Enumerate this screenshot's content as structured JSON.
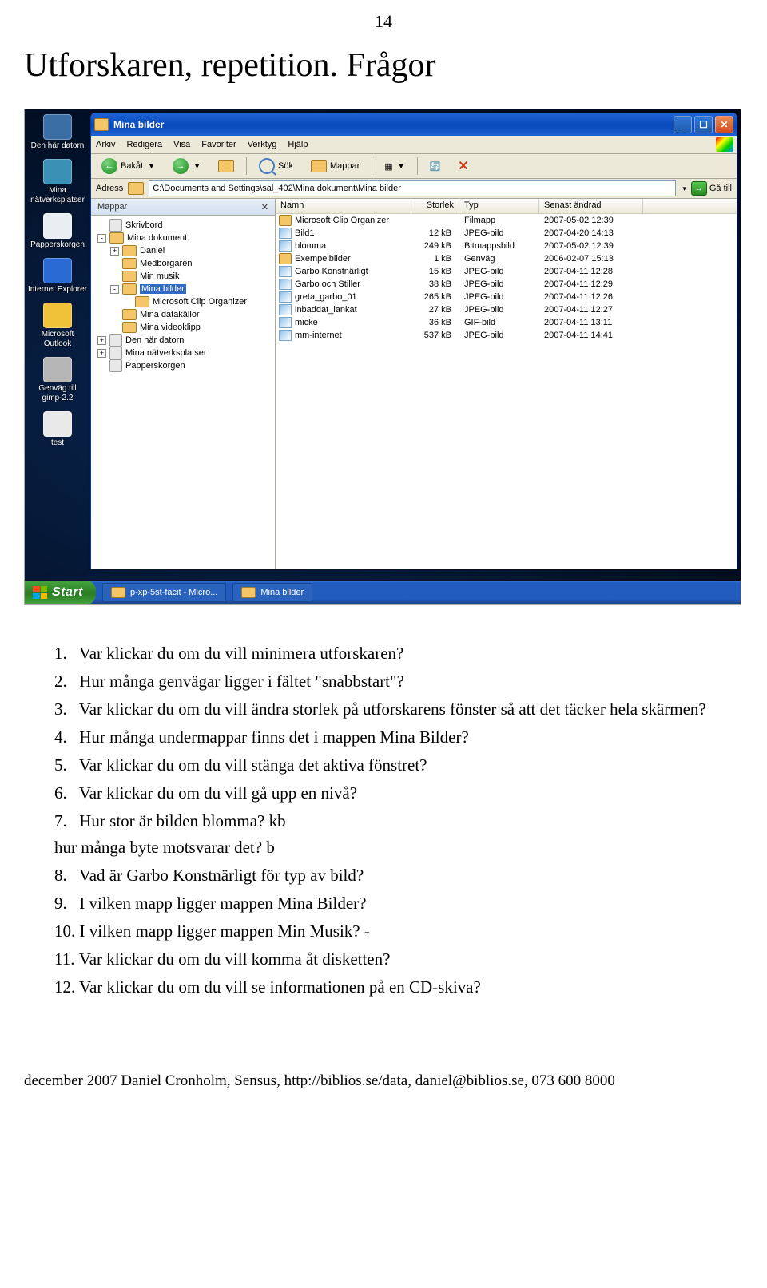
{
  "page_number": "14",
  "doc_title": "Utforskaren, repetition. Frågor",
  "desktop_icons": [
    {
      "label": "Den här datorn",
      "color": "#3b6ea5"
    },
    {
      "label": "Mina nätverksplatser",
      "color": "#3b90b5"
    },
    {
      "label": "Papperskorgen",
      "color": "#e8eef1"
    },
    {
      "label": "Internet Explorer",
      "color": "#2a6ad4"
    },
    {
      "label": "Microsoft Outlook",
      "color": "#efc23a"
    },
    {
      "label": "Genväg till gimp-2.2",
      "color": "#b6b6b6"
    },
    {
      "label": "test",
      "color": "#e9e9e9"
    }
  ],
  "window": {
    "title": "Mina bilder",
    "menu": [
      "Arkiv",
      "Redigera",
      "Visa",
      "Favoriter",
      "Verktyg",
      "Hjälp"
    ],
    "toolbar": {
      "back": "Bakåt",
      "search": "Sök",
      "folders": "Mappar"
    },
    "address": {
      "label": "Adress",
      "value": "C:\\Documents and Settings\\sal_402\\Mina dokument\\Mina bilder",
      "go": "Gå till"
    },
    "folders_header": "Mappar",
    "tree": [
      {
        "indent": 0,
        "pm": "",
        "icon": "d",
        "name": "Skrivbord"
      },
      {
        "indent": 0,
        "pm": "-",
        "icon": "f",
        "name": "Mina dokument"
      },
      {
        "indent": 1,
        "pm": "+",
        "icon": "f",
        "name": "Daniel"
      },
      {
        "indent": 1,
        "pm": "",
        "icon": "f",
        "name": "Medborgaren"
      },
      {
        "indent": 1,
        "pm": "",
        "icon": "f",
        "name": "Min musik"
      },
      {
        "indent": 1,
        "pm": "-",
        "icon": "f",
        "name": "Mina bilder",
        "sel": true
      },
      {
        "indent": 2,
        "pm": "",
        "icon": "f",
        "name": "Microsoft Clip Organizer"
      },
      {
        "indent": 1,
        "pm": "",
        "icon": "f",
        "name": "Mina datakällor"
      },
      {
        "indent": 1,
        "pm": "",
        "icon": "f",
        "name": "Mina videoklipp"
      },
      {
        "indent": 0,
        "pm": "+",
        "icon": "d",
        "name": "Den här datorn"
      },
      {
        "indent": 0,
        "pm": "+",
        "icon": "d",
        "name": "Mina nätverksplatser"
      },
      {
        "indent": 0,
        "pm": "",
        "icon": "d",
        "name": "Papperskorgen"
      }
    ],
    "columns": {
      "name": "Namn",
      "size": "Storlek",
      "type": "Typ",
      "date": "Senast ändrad"
    },
    "files": [
      {
        "name": "Microsoft Clip Organizer",
        "size": "",
        "type": "Filmapp",
        "date": "2007-05-02 12:39",
        "icon": "f"
      },
      {
        "name": "Bild1",
        "size": "12 kB",
        "type": "JPEG-bild",
        "date": "2007-04-20 14:13",
        "icon": "i"
      },
      {
        "name": "blomma",
        "size": "249 kB",
        "type": "Bitmappsbild",
        "date": "2007-05-02 12:39",
        "icon": "i"
      },
      {
        "name": "Exempelbilder",
        "size": "1 kB",
        "type": "Genväg",
        "date": "2006-02-07 15:13",
        "icon": "f"
      },
      {
        "name": "Garbo Konstnärligt",
        "size": "15 kB",
        "type": "JPEG-bild",
        "date": "2007-04-11 12:28",
        "icon": "i"
      },
      {
        "name": "Garbo och Stiller",
        "size": "38 kB",
        "type": "JPEG-bild",
        "date": "2007-04-11 12:29",
        "icon": "i"
      },
      {
        "name": "greta_garbo_01",
        "size": "265 kB",
        "type": "JPEG-bild",
        "date": "2007-04-11 12:26",
        "icon": "i"
      },
      {
        "name": "inbaddat_lankat",
        "size": "27 kB",
        "type": "JPEG-bild",
        "date": "2007-04-11 12:27",
        "icon": "i"
      },
      {
        "name": "micke",
        "size": "36 kB",
        "type": "GIF-bild",
        "date": "2007-04-11 13:11",
        "icon": "i"
      },
      {
        "name": "mm-internet",
        "size": "537 kB",
        "type": "JPEG-bild",
        "date": "2007-04-11 14:41",
        "icon": "i"
      }
    ]
  },
  "taskbar": {
    "start": "Start",
    "items": [
      "p-xp-5st-facit - Micro...",
      "Mina bilder"
    ]
  },
  "questions": [
    "Var klickar du om du vill minimera utforskaren?",
    "Hur många genvägar ligger i fältet \"snabbstart\"?                    ",
    "Var klickar du om du vill ändra storlek på utforskarens fönster så att det täcker hela skärmen?",
    "Hur många undermappar finns det i mappen Mina Bilder?                              ",
    "Var klickar du om du vill stänga det aktiva fönstret?",
    "Var klickar du om du vill gå upp en nivå?",
    "Hur stor är bilden blomma?                                    kb\n        hur många byte motsvarar det?                                        b",
    "Vad är Garbo Konstnärligt för typ av bild?                                             ",
    "I vilken mapp ligger mappen Mina Bilder?                                                  ",
    "I vilken mapp ligger mappen Min Musik?                                          -         ",
    "Var klickar du om du vill komma åt disketten?",
    "Var klickar du om du vill se informationen på en CD-skiva?"
  ],
  "footer": "december 2007 Daniel Cronholm, Sensus, http://biblios.se/data, daniel@biblios.se, 073 600 8000"
}
